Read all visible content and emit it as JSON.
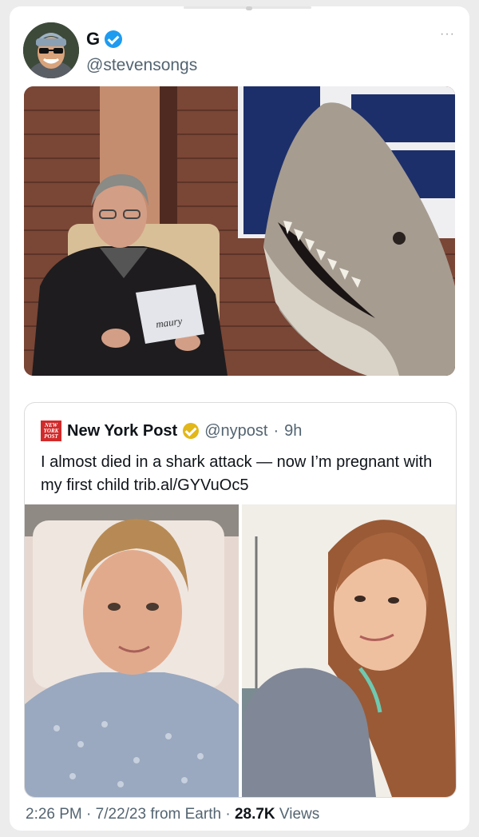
{
  "tweet": {
    "display_name": "G",
    "handle": "@stevensongs",
    "more_label": "···",
    "media_image_label": "maury"
  },
  "quoted": {
    "logo_text": "NEW YORK POST",
    "name": "New York Post",
    "handle": "@nypost",
    "separator": "·",
    "age": "9h",
    "text": "I almost died in a shark attack — now I’m pregnant with my first child trib.al/GYVuOc5"
  },
  "footer": {
    "time": "2:26 PM",
    "date": "7/22/23",
    "source": "from Earth",
    "views_count": "28.7K",
    "views_label": "Views",
    "dot": "·"
  },
  "colors": {
    "verified_blue": "#1d9bf0",
    "verified_gold": "#e2b719",
    "nypost_red": "#d22a2a"
  }
}
